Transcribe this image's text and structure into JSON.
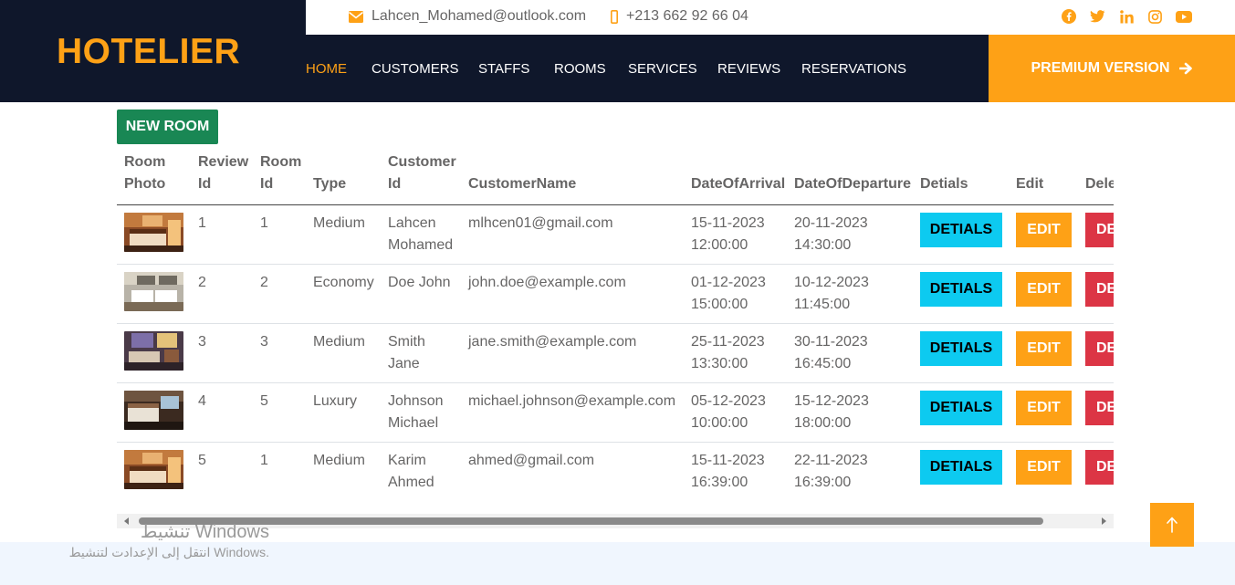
{
  "brand": {
    "name": "HOTELIER"
  },
  "topbar": {
    "email": "Lahcen_Mohamed@outlook.com",
    "phone": "+213 662 92 66 04",
    "socials": [
      "facebook-icon",
      "twitter-icon",
      "linkedin-icon",
      "instagram-icon",
      "youtube-icon"
    ]
  },
  "nav": {
    "items": [
      {
        "label": "HOME",
        "active": true
      },
      {
        "label": "CUSTOMERS",
        "active": false
      },
      {
        "label": "STAFFS",
        "active": false
      },
      {
        "label": "ROOMS",
        "active": false
      },
      {
        "label": "SERVICES",
        "active": false
      },
      {
        "label": "REVIEWS",
        "active": false
      },
      {
        "label": "RESERVATIONS",
        "active": false
      }
    ],
    "premium_label": "PREMIUM VERSION"
  },
  "actions": {
    "new_room_label": "NEW ROOM"
  },
  "table": {
    "headers": {
      "photo": "Room Photo",
      "review_id": "Review Id",
      "room_id": "Room Id",
      "type": "Type",
      "customer_id": "Customer Id",
      "customer_name": "CustomerName",
      "arrival": "DateOfArrival",
      "departure": "DateOfDeparture",
      "details": "Detials",
      "edit": "Edit",
      "delete": "Delete"
    },
    "rows": [
      {
        "review_id": "1",
        "room_id": "1",
        "type": "Medium",
        "customer_id": "Lahcen Mohamed",
        "customer_name": "mlhcen01@gmail.com",
        "arrival": "15-11-2023 12:00:00",
        "departure": "20-11-2023 14:30:00"
      },
      {
        "review_id": "2",
        "room_id": "2",
        "type": "Economy",
        "customer_id": "Doe John",
        "customer_name": "john.doe@example.com",
        "arrival": "01-12-2023 15:00:00",
        "departure": "10-12-2023 11:45:00"
      },
      {
        "review_id": "3",
        "room_id": "3",
        "type": "Medium",
        "customer_id": "Smith Jane",
        "customer_name": "jane.smith@example.com",
        "arrival": "25-11-2023 13:30:00",
        "departure": "30-11-2023 16:45:00"
      },
      {
        "review_id": "4",
        "room_id": "5",
        "type": "Luxury",
        "customer_id": "Johnson Michael",
        "customer_name": "michael.johnson@example.com",
        "arrival": "05-12-2023 10:00:00",
        "departure": "15-12-2023 18:00:00"
      },
      {
        "review_id": "5",
        "room_id": "1",
        "type": "Medium",
        "customer_id": "Karim Ahmed",
        "customer_name": "ahmed@gmail.com",
        "arrival": "15-11-2023 16:39:00",
        "departure": "22-11-2023 16:39:00"
      }
    ],
    "buttons": {
      "details": "DETIALS",
      "edit": "EDIT",
      "delete": "DELETE"
    }
  },
  "windows_overlay": {
    "title": "تنشيط Windows",
    "subtitle": "انتقل إلى الإعدادت لتنشيط Windows."
  },
  "colors": {
    "navy": "#0f172b",
    "accent": "#fea116",
    "success": "#198754",
    "info": "#0dcaf0",
    "danger": "#dc3545"
  }
}
